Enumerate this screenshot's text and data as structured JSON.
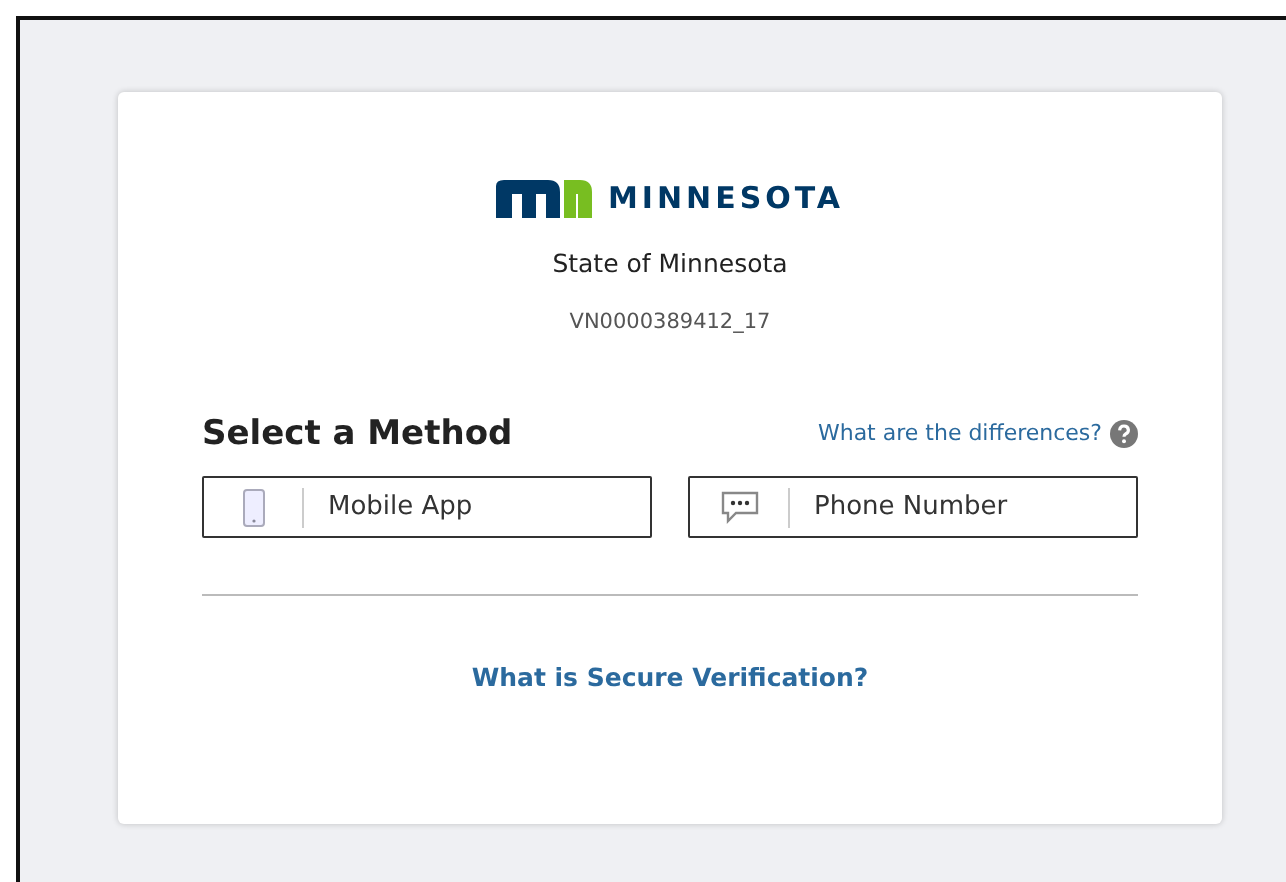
{
  "logo": {
    "wordmark": "MINNESOTA"
  },
  "org": "State of Minnesota",
  "code": "VN0000389412_17",
  "heading": "Select a Method",
  "help_link": "What are the differences?",
  "methods": [
    {
      "kind": "app",
      "label": "Mobile App"
    },
    {
      "kind": "sms",
      "label": "Phone Number"
    }
  ],
  "footer_link": "What is Secure Verification?"
}
